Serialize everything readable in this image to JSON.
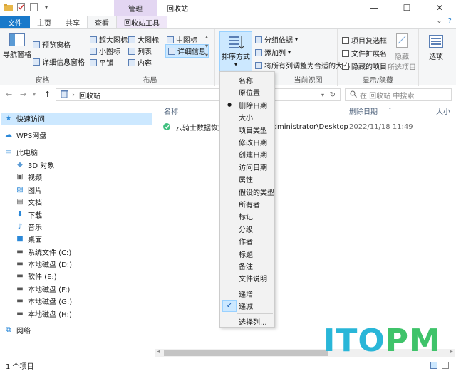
{
  "window": {
    "title": "回收站",
    "context_tab_group": "管理",
    "minimize": "—",
    "maximize": "☐",
    "close": "✕"
  },
  "ribbon_tabs": {
    "file": "文件",
    "home": "主页",
    "share": "共享",
    "view": "查看",
    "recycle_tools": "回收站工具"
  },
  "ribbon": {
    "pane_group": {
      "label": "窗格",
      "nav_pane": "导航窗格",
      "preview_pane": "预览窗格",
      "details_pane": "详细信息窗格"
    },
    "layout_group": {
      "label": "布局",
      "extra_large": "超大图标",
      "large": "大图标",
      "medium": "中图标",
      "small": "小图标",
      "list": "列表",
      "details": "详细信息",
      "tiles": "平铺",
      "content": "内容"
    },
    "current_view_group": {
      "label": "当前视图",
      "sort_by": "排序方式",
      "group_by": "分组依据",
      "add_columns": "添加列",
      "size_all_columns": "将所有列调整为合适的大小"
    },
    "show_hide_group": {
      "label": "显示/隐藏",
      "item_checkboxes": "项目复选框",
      "file_extensions": "文件扩展名",
      "hidden_items": "隐藏的项目",
      "hide_selected": "隐藏",
      "hide_selected_2": "所选项目"
    },
    "options": "选项"
  },
  "address_bar": {
    "path": "回收站",
    "search_placeholder": "在 回收站 中搜索"
  },
  "nav_pane": {
    "items": [
      {
        "label": "快速访问",
        "icon": "star-icon"
      },
      {
        "label": "WPS网盘",
        "icon": "cloud-icon"
      },
      {
        "label": "此电脑",
        "icon": "computer-icon"
      },
      {
        "label": "3D 对象",
        "icon": "cube-icon"
      },
      {
        "label": "视频",
        "icon": "video-icon"
      },
      {
        "label": "图片",
        "icon": "picture-icon"
      },
      {
        "label": "文档",
        "icon": "document-icon"
      },
      {
        "label": "下载",
        "icon": "download-icon"
      },
      {
        "label": "音乐",
        "icon": "music-icon"
      },
      {
        "label": "桌面",
        "icon": "desktop-icon"
      },
      {
        "label": "系统文件 (C:)",
        "icon": "drive-icon"
      },
      {
        "label": "本地磁盘 (D:)",
        "icon": "drive-icon"
      },
      {
        "label": "软件 (E:)",
        "icon": "drive-icon"
      },
      {
        "label": "本地磁盘 (F:)",
        "icon": "drive-icon"
      },
      {
        "label": "本地磁盘 (G:)",
        "icon": "drive-icon"
      },
      {
        "label": "本地磁盘 (H:)",
        "icon": "drive-icon"
      },
      {
        "label": "网络",
        "icon": "network-icon"
      }
    ]
  },
  "columns": {
    "name": "名称",
    "original_location": "原位置",
    "date_deleted": "删除日期",
    "size": "大小"
  },
  "files": [
    {
      "name": "云骑士数据恢复",
      "location": "Administrator\\Desktop",
      "date_deleted": "2022/11/18 11:49"
    }
  ],
  "sort_menu": {
    "fields": [
      "名称",
      "原位置",
      "删除日期",
      "大小",
      "项目类型",
      "修改日期",
      "创建日期",
      "访问日期",
      "属性",
      "假设的类型",
      "所有者",
      "标记",
      "分级",
      "作者",
      "标题",
      "备注",
      "文件说明"
    ],
    "selected_field": "删除日期",
    "ascending": "递增",
    "descending": "递减",
    "selected_order": "递减",
    "choose_columns": "选择列..."
  },
  "status": {
    "item_count": "1 个项目"
  },
  "watermark": {
    "part1": "ITO",
    "part2": "PM"
  },
  "colors": {
    "accent": "#1979ca",
    "selection": "#cce8ff",
    "context_tab": "#e3d6f2"
  }
}
